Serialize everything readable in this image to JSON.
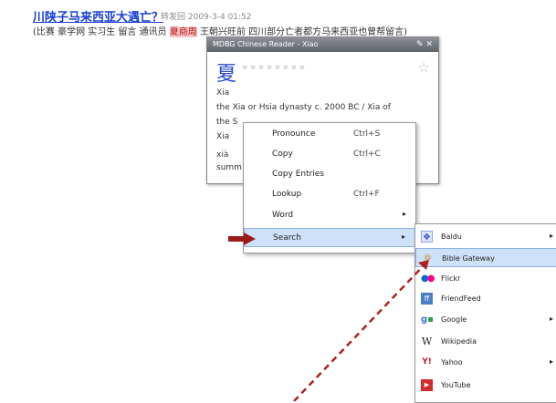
{
  "header": {
    "title": "川陕子马来西亚大遇亡？",
    "meta": "转发回 2009-3-4 01:52",
    "sub_pre": "(比赛 豪学网 实习生 留言 通讯员 ",
    "sub_highlight": "夏商周",
    "sub_post": " 王朝兴旺前 四川部分亡者都方马来西亚也曾帮留言)"
  },
  "popup": {
    "window_title": "MDBG Chinese Reader - Xiao",
    "window_buttons": "✎ ✕",
    "character": "夏",
    "pinyin": "Xia",
    "definition": "the Xia or Hsia dynasty c. 2000 BC / Xia of",
    "line3": "the S",
    "line4": "Xia",
    "line5": "xià",
    "line6": "summ"
  },
  "context_menu": {
    "items": [
      {
        "label": "Pronounce",
        "shortcut": "Ctrl+S"
      },
      {
        "label": "Copy",
        "shortcut": "Ctrl+C"
      },
      {
        "label": "Copy Entries",
        "shortcut": ""
      },
      {
        "label": "Lookup",
        "shortcut": "Ctrl+F"
      },
      {
        "label": "Word",
        "shortcut": "▸"
      },
      {
        "label": "Search",
        "shortcut": "▸"
      }
    ]
  },
  "search_submenu": {
    "items": [
      {
        "label": "Baidu",
        "icon": "baidu-icon",
        "has_submenu": true
      },
      {
        "label": "Bible Gateway",
        "icon": "bible-gateway-icon",
        "has_submenu": false
      },
      {
        "label": "Flickr",
        "icon": "flickr-icon",
        "has_submenu": false
      },
      {
        "label": "FriendFeed",
        "icon": "friendfeed-icon",
        "has_submenu": false
      },
      {
        "label": "Google",
        "icon": "google-icon",
        "has_submenu": true
      },
      {
        "label": "Wikipedia",
        "icon": "wikipedia-icon",
        "has_submenu": false
      },
      {
        "label": "Yahoo",
        "icon": "yahoo-icon",
        "has_submenu": true
      },
      {
        "label": "YouTube",
        "icon": "youtube-icon",
        "has_submenu": false
      }
    ]
  },
  "colors": {
    "accent": "#1a3fd6",
    "highlight": "#cde2f8",
    "arrow": "#9b1b1b",
    "dash": "#b02020"
  }
}
